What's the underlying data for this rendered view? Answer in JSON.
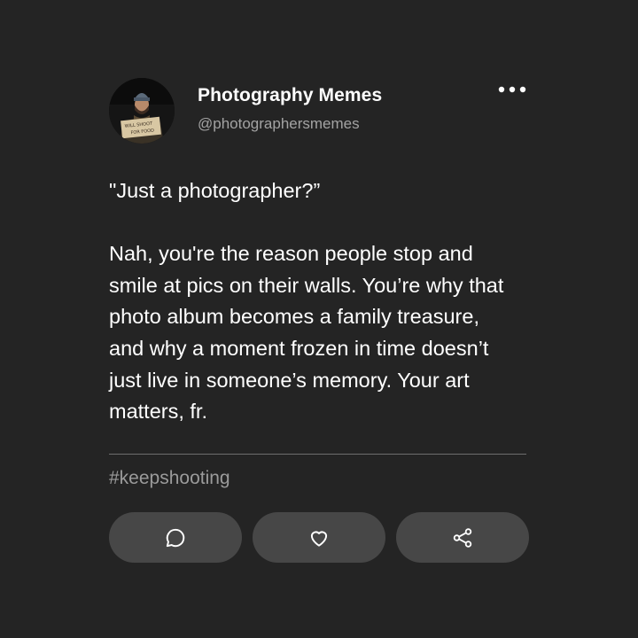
{
  "post": {
    "author_name": "Photography Memes",
    "author_handle": "@photographersmemes",
    "avatar": {
      "sign_line_1": "WILL SHOOT",
      "sign_line_2": "FOR FOOD"
    },
    "quote_line": "\"Just a photographer?”",
    "paragraph_lines": [
      "Nah, you're the reason people stop and",
      "smile at pics on their walls. You’re why that",
      "photo album becomes a family treasure,",
      "and why a moment frozen in time doesn’t",
      "just live in someone’s memory. Your art",
      "matters, fr."
    ],
    "hashtag": "#keepshooting"
  },
  "actions": {
    "more_icon": "more-dots-icon",
    "comment_icon": "comment-icon",
    "like_icon": "heart-icon",
    "share_icon": "share-icon"
  },
  "colors": {
    "background": "#242424",
    "button": "#474747",
    "text": "#ffffff",
    "muted": "#a3a3a3"
  }
}
